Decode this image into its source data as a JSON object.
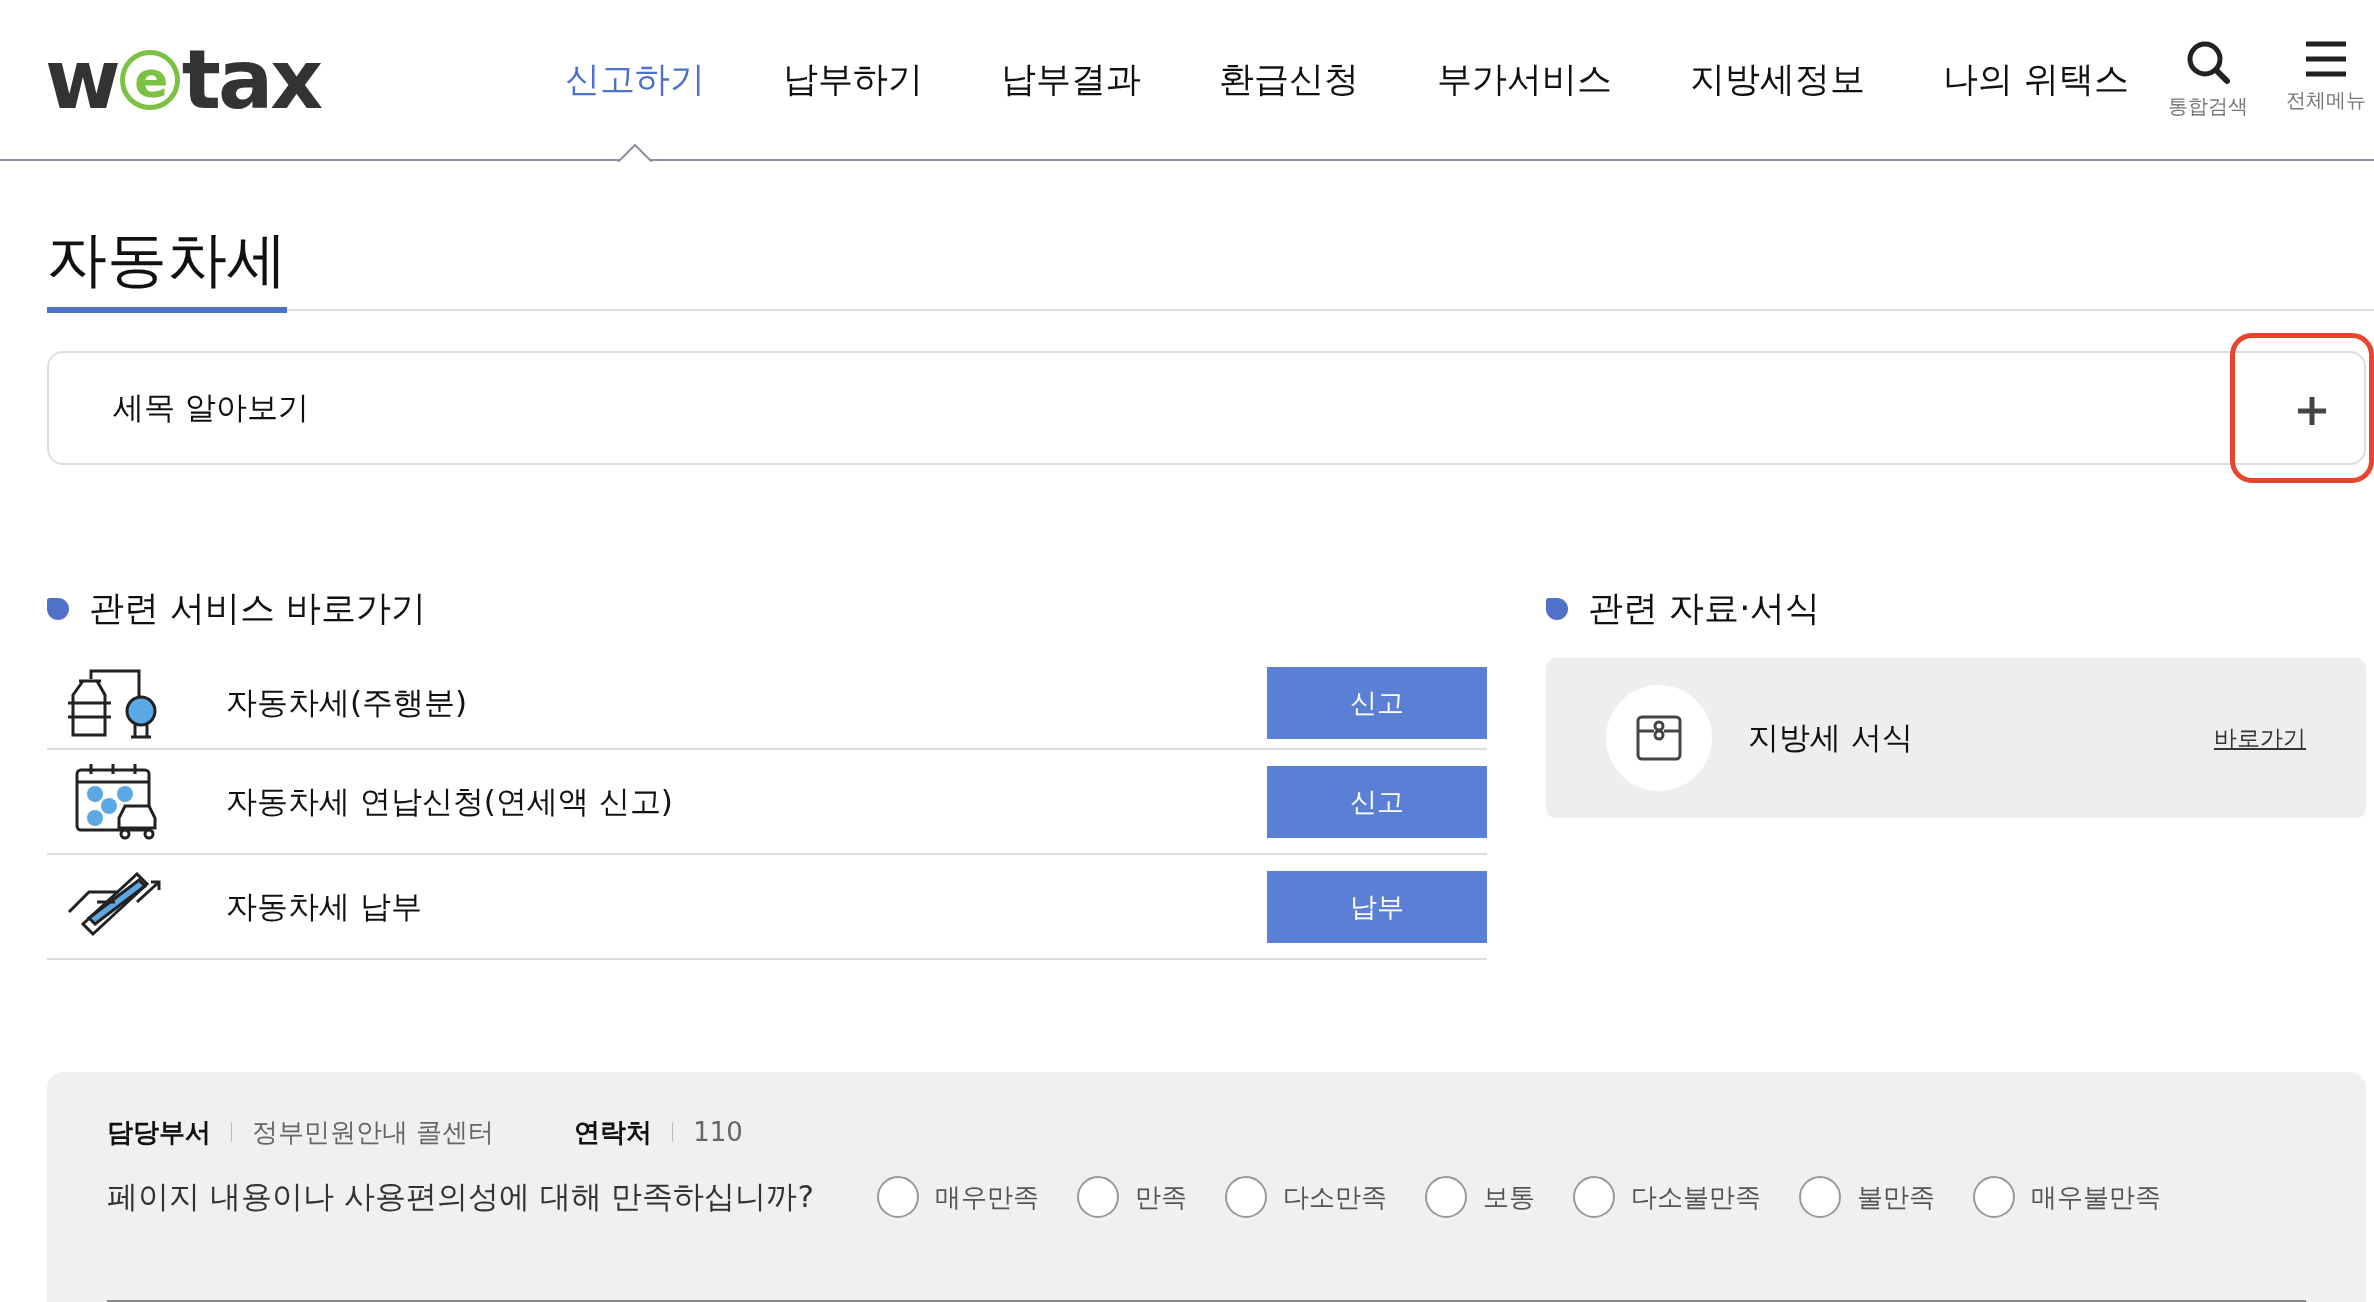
{
  "logo": {
    "parts": [
      {
        "text": "w",
        "kind": "plain"
      },
      {
        "text": "e",
        "kind": "circled"
      },
      {
        "text": "tax",
        "kind": "plain"
      }
    ]
  },
  "nav": [
    {
      "label": "신고하기",
      "selected": true
    },
    {
      "label": "납부하기",
      "selected": false
    },
    {
      "label": "납부결과",
      "selected": false
    },
    {
      "label": "환급신청",
      "selected": false
    },
    {
      "label": "부가서비스",
      "selected": false
    },
    {
      "label": "지방세정보",
      "selected": false
    },
    {
      "label": "나의 위택스",
      "selected": false
    }
  ],
  "header_tools": [
    {
      "label": "통합검색",
      "kind": "search"
    },
    {
      "label": "전체메뉴",
      "kind": "menu"
    }
  ],
  "page_title": "자동차세",
  "accordion": {
    "label": "세목 알아보기",
    "expanded": false,
    "highlighted": true
  },
  "services": {
    "heading": "관련 서비스 바로가기",
    "items": [
      {
        "label": "자동차세(주행분)",
        "kind": "oil",
        "button": "신고"
      },
      {
        "label": "자동차세 연납신청(연세액 신고)",
        "kind": "calendar",
        "button": "신고"
      },
      {
        "label": "자동차세 납부",
        "kind": "card",
        "button": "납부"
      }
    ]
  },
  "resources": {
    "heading": "관련 자료·서식",
    "items": [
      {
        "label": "지방세 서식",
        "link": "바로가기"
      }
    ]
  },
  "survey": {
    "department_label": "담당부서",
    "department": "정부민원안내 콜센터",
    "contact_label": "연락처",
    "contact": "110",
    "question": "페이지 내용이나 사용편의성에 대해 만족하십니까?",
    "options": [
      {
        "label": "매우만족",
        "selected": false
      },
      {
        "label": "만족",
        "selected": false
      },
      {
        "label": "다소만족",
        "selected": false
      },
      {
        "label": "보통",
        "selected": false
      },
      {
        "label": "다소불만족",
        "selected": false
      },
      {
        "label": "불만족",
        "selected": false
      },
      {
        "label": "매우불만족",
        "selected": false
      }
    ]
  }
}
